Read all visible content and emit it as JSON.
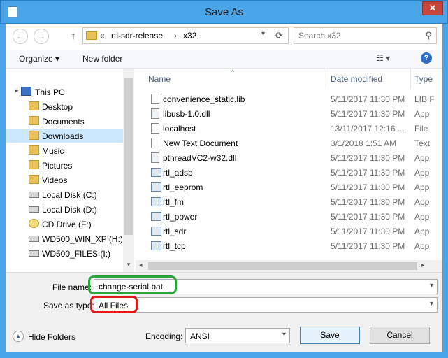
{
  "window": {
    "title": "Save As",
    "close_glyph": "✕"
  },
  "nav": {
    "back_glyph": "←",
    "forward_glyph": "→",
    "up_glyph": "↑",
    "breadcrumb_sep": "«",
    "path": [
      "rtl-sdr-release",
      "x32"
    ],
    "path_arrow": "›",
    "dropdown_glyph": "▾",
    "refresh_glyph": "⟳",
    "search_placeholder": "Search x32",
    "search_glyph": "⚲"
  },
  "toolbar": {
    "organize_label": "Organize ▾",
    "new_folder_label": "New folder",
    "view_glyph": "☷ ▾",
    "help_glyph": "?"
  },
  "sidebar": {
    "items": [
      {
        "label": "This PC",
        "icon": "computer-icon"
      },
      {
        "label": "Desktop",
        "icon": "folder-icon"
      },
      {
        "label": "Documents",
        "icon": "folder-icon"
      },
      {
        "label": "Downloads",
        "icon": "folder-icon",
        "selected": true
      },
      {
        "label": "Music",
        "icon": "folder-icon"
      },
      {
        "label": "Pictures",
        "icon": "folder-icon"
      },
      {
        "label": "Videos",
        "icon": "folder-icon"
      },
      {
        "label": "Local Disk (C:)",
        "icon": "drive-icon"
      },
      {
        "label": "Local Disk (D:)",
        "icon": "drive-icon"
      },
      {
        "label": "CD Drive (F:)",
        "icon": "cd-icon"
      },
      {
        "label": "WD500_WIN_XP (H:)",
        "icon": "drive-icon"
      },
      {
        "label": "WD500_FILES (I:)",
        "icon": "drive-icon"
      }
    ],
    "scroll_down_glyph": "▾"
  },
  "files": {
    "columns": {
      "name": "Name",
      "date": "Date modified",
      "type": "Type"
    },
    "sort_glyph": "^",
    "rows": [
      {
        "name": "convenience_static.lib",
        "date": "5/11/2017 11:30 PM",
        "type": "LIB F",
        "icon": "file-icon"
      },
      {
        "name": "libusb-1.0.dll",
        "date": "5/11/2017 11:30 PM",
        "type": "App",
        "icon": "dll-icon"
      },
      {
        "name": "localhost",
        "date": "13/11/2017 12:16 ...",
        "type": "File",
        "icon": "file-icon"
      },
      {
        "name": "New Text Document",
        "date": "3/1/2018 1:51 AM",
        "type": "Text",
        "icon": "file-icon"
      },
      {
        "name": "pthreadVC2-w32.dll",
        "date": "5/11/2017 11:30 PM",
        "type": "App",
        "icon": "dll-icon"
      },
      {
        "name": "rtl_adsb",
        "date": "5/11/2017 11:30 PM",
        "type": "App",
        "icon": "exe-icon"
      },
      {
        "name": "rtl_eeprom",
        "date": "5/11/2017 11:30 PM",
        "type": "App",
        "icon": "exe-icon"
      },
      {
        "name": "rtl_fm",
        "date": "5/11/2017 11:30 PM",
        "type": "App",
        "icon": "exe-icon"
      },
      {
        "name": "rtl_power",
        "date": "5/11/2017 11:30 PM",
        "type": "App",
        "icon": "exe-icon"
      },
      {
        "name": "rtl_sdr",
        "date": "5/11/2017 11:30 PM",
        "type": "App",
        "icon": "exe-icon"
      },
      {
        "name": "rtl_tcp",
        "date": "5/11/2017 11:30 PM",
        "type": "App",
        "icon": "exe-icon"
      }
    ],
    "hscroll_left_glyph": "◂",
    "hscroll_right_glyph": "▸"
  },
  "save": {
    "file_name_label": "File name:",
    "file_name_value": "change-serial.bat",
    "save_as_type_label": "Save as type:",
    "save_as_type_value": "All Files",
    "encoding_label": "Encoding:",
    "encoding_value": "ANSI",
    "save_button": "Save",
    "cancel_button": "Cancel",
    "hide_folders_label": "Hide Folders",
    "hide_folders_glyph": "▲",
    "dropdown_glyph": "▾"
  },
  "annotations": {
    "green": "#2aa33a",
    "red": "#e01a1a"
  }
}
